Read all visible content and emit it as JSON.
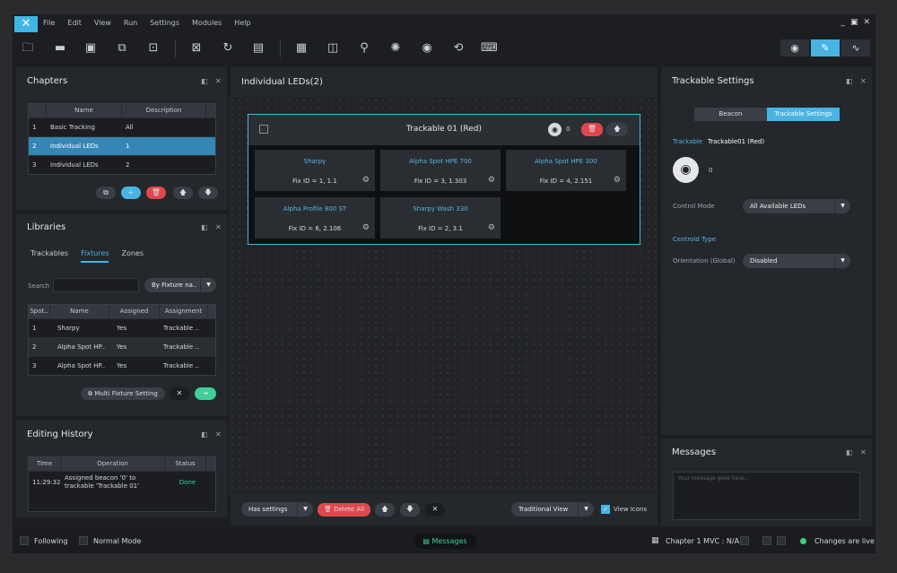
{
  "app": {
    "menu": [
      "File",
      "Edit",
      "View",
      "Run",
      "Settings",
      "Modules",
      "Help"
    ],
    "window_controls": [
      "_",
      "▣",
      "✕"
    ]
  },
  "chapters": {
    "title": "Chapters",
    "columns": [
      "Name",
      "Description"
    ],
    "rows": [
      {
        "num": "1",
        "name": "Basic Tracking",
        "desc": "All"
      },
      {
        "num": "2",
        "name": "Individual LEDs",
        "desc": "1"
      },
      {
        "num": "3",
        "name": "Individual LEDs",
        "desc": "2"
      }
    ],
    "selected_row": 1
  },
  "libraries": {
    "title": "Libraries",
    "tabs": [
      "Trackables",
      "Fixtures",
      "Zones"
    ],
    "active_tab": "Fixtures",
    "search_label": "Search",
    "search_value": "",
    "sort_value": "By Fixture na..",
    "columns": [
      "Spot..",
      "Name",
      "Assigned",
      "Assignment"
    ],
    "rows": [
      {
        "spot": "1",
        "name": "Sharpy",
        "assigned": "Yes",
        "assignment": "Trackable .."
      },
      {
        "spot": "2",
        "name": "Alpha Spot HP..",
        "assigned": "Yes",
        "assignment": "Trackable .."
      },
      {
        "spot": "3",
        "name": "Alpha Spot HP..",
        "assigned": "Yes",
        "assignment": "Trackable .."
      }
    ],
    "multi_fixture_label": "Multi Fixture Setting"
  },
  "history": {
    "title": "Editing History",
    "columns": [
      "Time",
      "Operation",
      "Status"
    ],
    "rows": [
      {
        "time": "11:29:32",
        "op_line1": "Assigned beacon '0' to",
        "op_line2": "trackable 'Trackable 01'",
        "status": "Done"
      }
    ]
  },
  "center": {
    "title": "Individual LEDs(2)",
    "trackable": {
      "name": "Trackable 01 (Red)",
      "beacon_count": "0",
      "fixtures": [
        {
          "name": "Sharpy",
          "fix_id": "Fix ID = 1, 1.1"
        },
        {
          "name": "Alpha Spot HPE 700",
          "fix_id": "Fix ID = 3, 1.303"
        },
        {
          "name": "Alpha Spot HPE 300",
          "fix_id": "Fix ID = 4, 2.151"
        },
        {
          "name": "Alpha Profile 800 ST",
          "fix_id": "Fix ID = 6, 2.106"
        },
        {
          "name": "Sharpy Wash 330",
          "fix_id": "Fix ID = 2, 3.1"
        }
      ]
    },
    "filter_value": "Has settings",
    "delete_all_label": "Delete All",
    "view_value": "Traditional View",
    "view_icons_label": "View Icons",
    "view_icons_checked": true
  },
  "trackable_settings": {
    "title": "Trackable Settings",
    "tabs": [
      "Beacon",
      "Trackable Settings"
    ],
    "active_tab": "Trackable Settings",
    "trackable_label": "Trackable",
    "trackable_value": "Trackable01 (Red)",
    "beacon_count": "0",
    "control_mode_label": "Control Mode",
    "control_mode_value": "All Available LEDs",
    "centroid_heading": "Centroid Type",
    "orientation_label": "Orientation (Global)",
    "orientation_value": "Disabled"
  },
  "messages": {
    "title": "Messages",
    "placeholder": "Your message goes here..."
  },
  "statusbar": {
    "following_label": "Following",
    "normal_mode_label": "Normal Mode",
    "messages_label": "Messages",
    "chapter_label": "Chapter 1 MVC : N/A",
    "live_label": "Changes are live"
  },
  "colors": {
    "accent": "#3fb7e6",
    "delete": "#e0474c",
    "go": "#3ecf9a",
    "live": "#3ecf7a"
  }
}
